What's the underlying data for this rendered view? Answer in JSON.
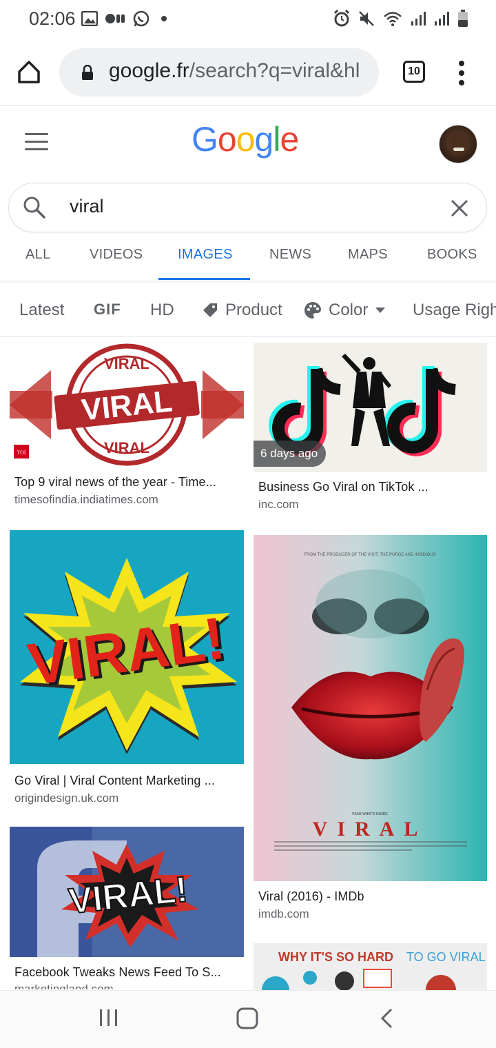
{
  "status_bar": {
    "time": "02:06",
    "icons": [
      "gallery-icon",
      "media-icon",
      "whatsapp-icon",
      "dot-icon",
      "alarm-icon",
      "mute-icon",
      "wifi-icon",
      "signal-icon",
      "signal-icon",
      "battery-icon"
    ]
  },
  "browser": {
    "url_domain": "google.fr",
    "url_path": "/search?q=viral&hl",
    "tab_count": "10"
  },
  "google": {
    "logo_letters": [
      "G",
      "o",
      "o",
      "g",
      "l",
      "e"
    ],
    "logo_colors": [
      "#4285F4",
      "#EA4335",
      "#FBBC05",
      "#4285F4",
      "#34A853",
      "#EA4335"
    ]
  },
  "search": {
    "query": "viral"
  },
  "tabs": [
    {
      "label": "ALL",
      "active": false
    },
    {
      "label": "VIDEOS",
      "active": false
    },
    {
      "label": "IMAGES",
      "active": true
    },
    {
      "label": "NEWS",
      "active": false
    },
    {
      "label": "MAPS",
      "active": false
    },
    {
      "label": "BOOKS",
      "active": false
    }
  ],
  "filters": {
    "latest": "Latest",
    "gif": "GIF",
    "hd": "HD",
    "product": "Product",
    "color": "Color",
    "usage": "Usage Righ"
  },
  "results": [
    {
      "title": "Top 9 viral news of the year - Time...",
      "source": "timesofindia.indiatimes.com",
      "image_text": [
        "VIRAL",
        "VIRAL",
        "VIRAL"
      ],
      "logo": "TOI"
    },
    {
      "title": "Business Go Viral on TikTok ...",
      "source": "inc.com",
      "badge": "6 days ago"
    },
    {
      "title": "Go Viral | Viral Content Marketing ...",
      "source": "origindesign.uk.com",
      "image_text": [
        "VIRAL!"
      ]
    },
    {
      "title": "Viral (2016) - IMDb",
      "source": "imdb.com",
      "image_text": [
        "FROM THE PRODUCER OF THE VISIT, THE PURGE AND INSIDIOUS",
        "FEAR WHAT'S INSIDE",
        "VIRAL"
      ]
    },
    {
      "title": "Facebook Tweaks News Feed To S...",
      "source": "marketingland.com",
      "image_text": [
        "VIRAL!"
      ]
    },
    {
      "title": "",
      "source": "",
      "image_text": [
        "WHY IT'S SO HARD",
        "TO GO VIRAL"
      ]
    }
  ],
  "colors": {
    "accent": "#1a73e8",
    "text_secondary": "#5f6368"
  }
}
